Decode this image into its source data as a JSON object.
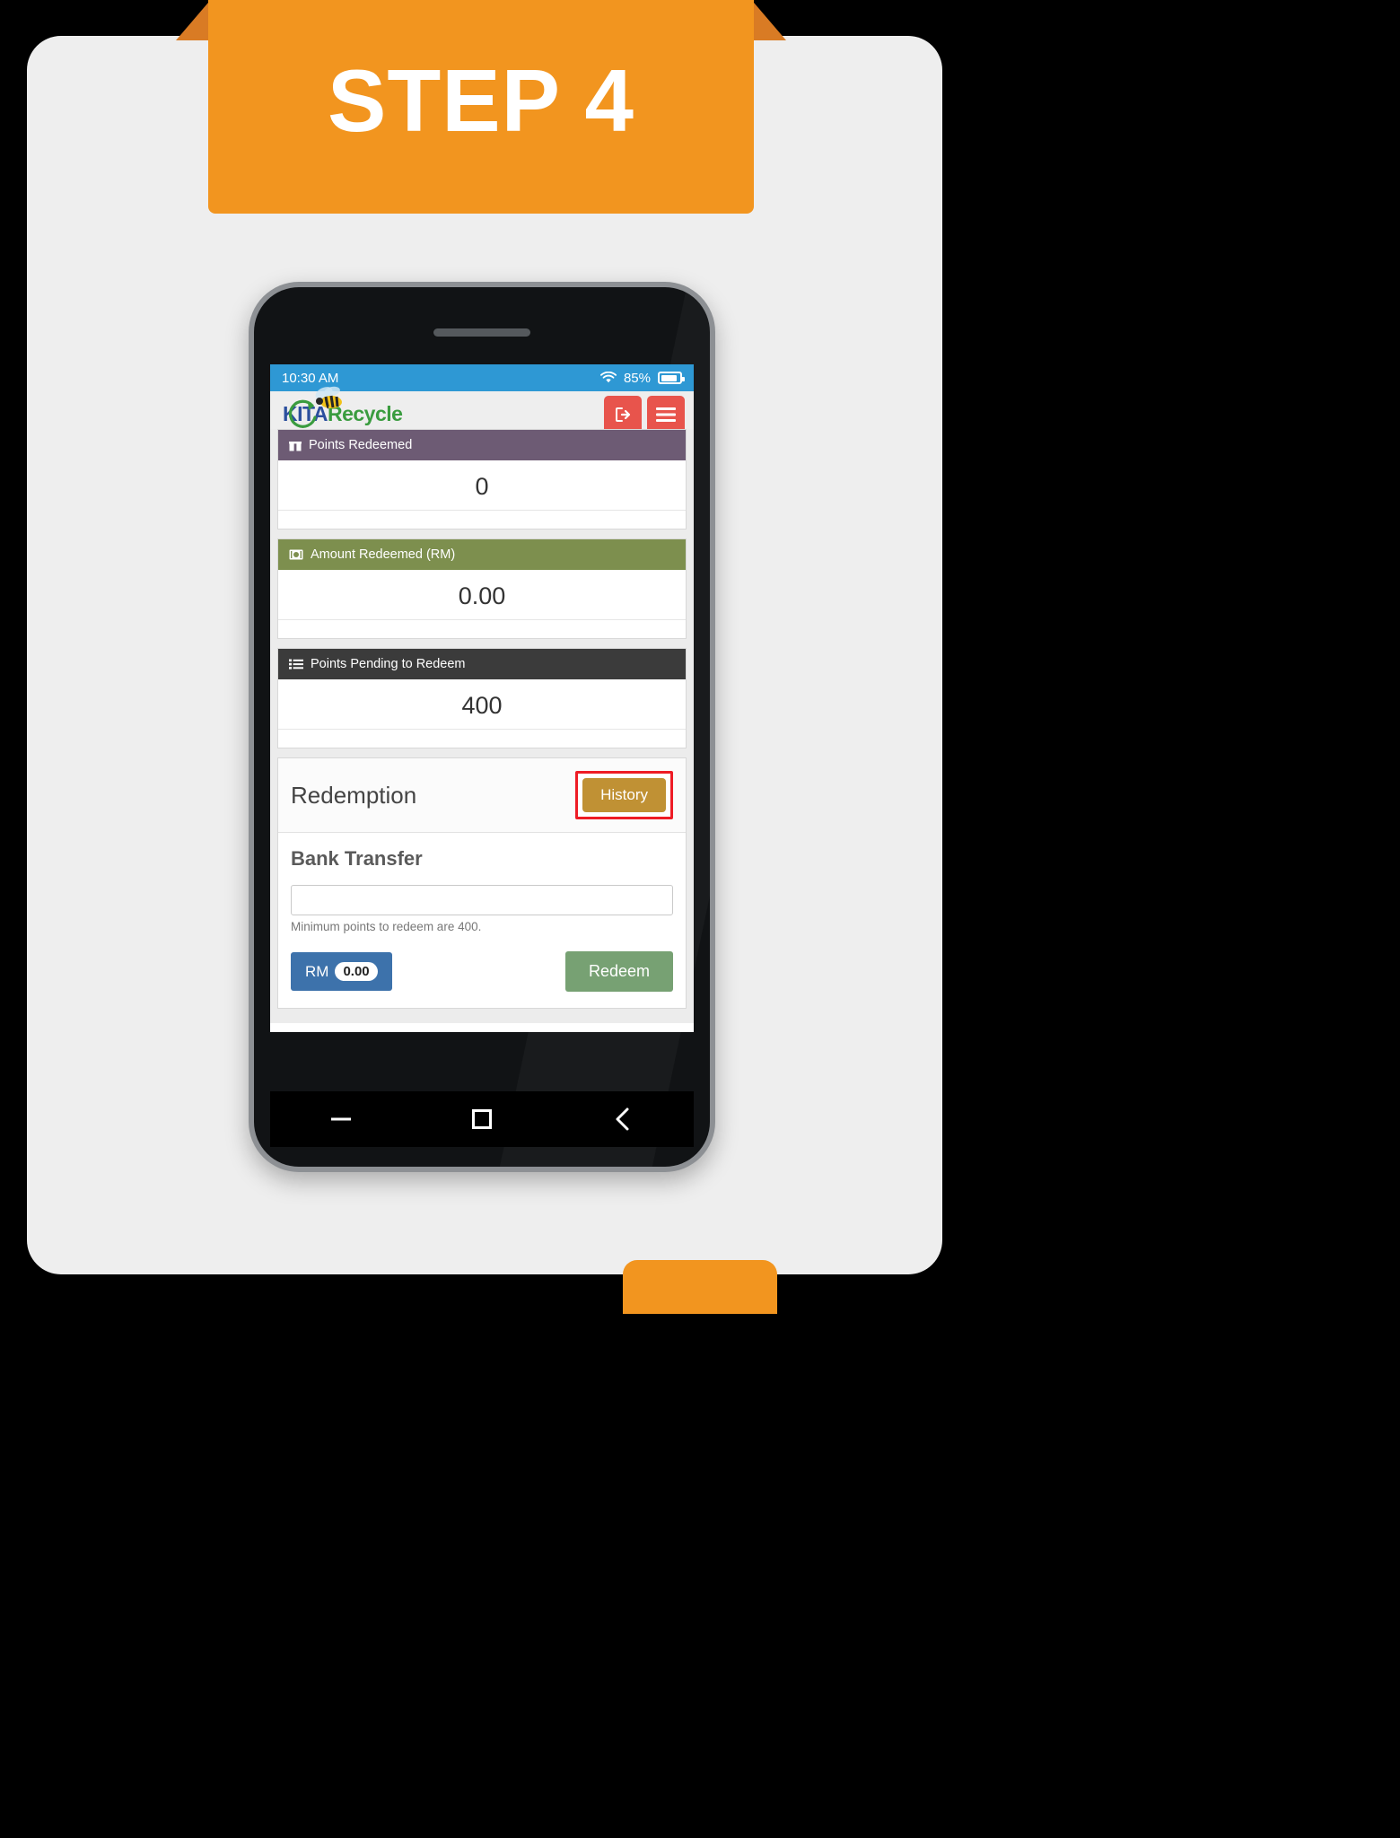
{
  "banner": {
    "label": "STEP 4"
  },
  "phone": {
    "statusbar": {
      "time": "10:30 AM",
      "battery_percent": "85%",
      "wifi_icon": "wifi-icon",
      "battery_icon": "battery-icon"
    },
    "appbar": {
      "logo_part1": "KITA",
      "logo_part2": "Recycle",
      "logout_icon": "logout-icon",
      "menu_icon": "hamburger-menu-icon"
    },
    "cards": [
      {
        "title": "Points Redeemed",
        "value": "0",
        "icon": "gift-icon",
        "color": "#6d5b74"
      },
      {
        "title": "Amount Redeemed (RM)",
        "value": "0.00",
        "icon": "money-bill-icon",
        "color": "#7d8f4e"
      },
      {
        "title": "Points Pending to Redeem",
        "value": "400",
        "icon": "list-icon",
        "color": "#3b3b3b"
      }
    ],
    "redemption": {
      "title": "Redemption",
      "history_label": "History",
      "history_color": "#c09134",
      "highlight_color": "#ee1c25",
      "bank_title": "Bank Transfer",
      "input_value": "",
      "input_placeholder": "",
      "hint": "Minimum points to redeem are 400.",
      "rm_label": "RM",
      "rm_amount": "0.00",
      "rm_color": "#3d72ab",
      "redeem_label": "Redeem",
      "redeem_color": "#77a173"
    },
    "navbar": {
      "minimize_icon": "minimize-icon",
      "recents_icon": "square-recents-icon",
      "back_icon": "chevron-back-icon"
    }
  }
}
